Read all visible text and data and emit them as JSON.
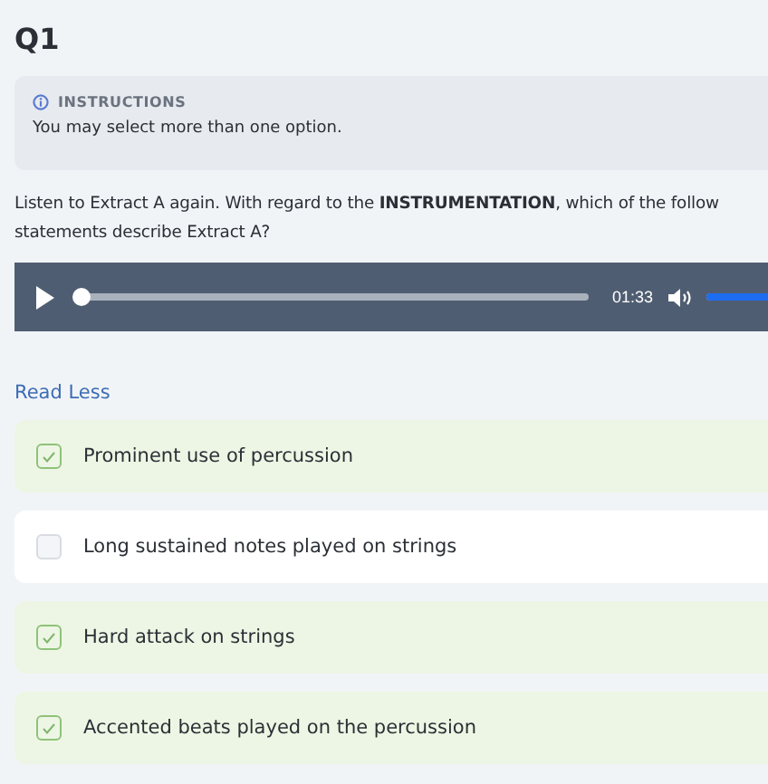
{
  "question": {
    "title": "Q1",
    "instructions": {
      "label": "INSTRUCTIONS",
      "text": "You may select more than one option."
    },
    "prompt_lines": [
      "Listen to Extract A again. With regard to the **INSTRUMENTATION**, which of the follow",
      "statements describe Extract A?"
    ]
  },
  "player": {
    "level": 0,
    "time": "01:33",
    "volume": {
      "level": 1
    }
  },
  "toggle_link": "Read Less",
  "options": [
    {
      "label": "Prominent use of percussion",
      "checked": true
    },
    {
      "label": "Long sustained notes played on strings",
      "checked": false
    },
    {
      "label": "Hard attack on strings",
      "checked": true
    },
    {
      "label": "Accented beats played on the percussion",
      "checked": true
    }
  ]
}
